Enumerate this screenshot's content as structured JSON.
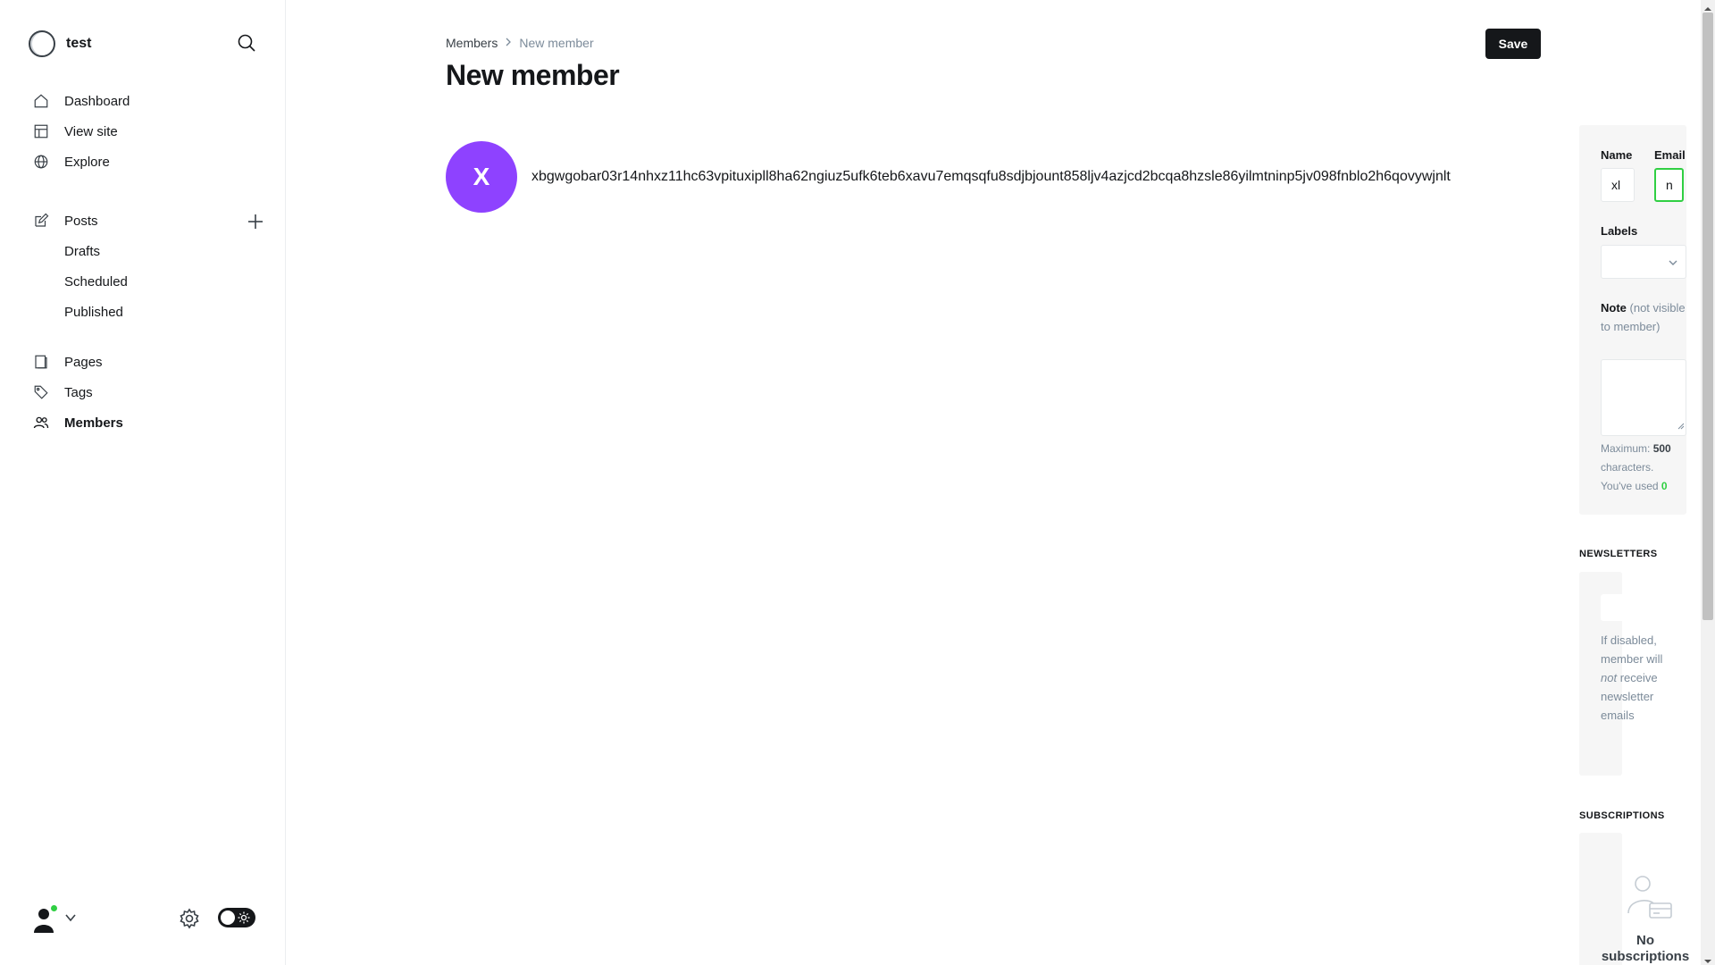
{
  "sidebar": {
    "brand": "test",
    "nav_main": [
      {
        "label": "Dashboard",
        "icon": "home-icon"
      },
      {
        "label": "View site",
        "icon": "layout-icon"
      },
      {
        "label": "Explore",
        "icon": "globe-icon"
      }
    ],
    "posts": {
      "label": "Posts",
      "sub": [
        "Drafts",
        "Scheduled",
        "Published"
      ]
    },
    "nav_bottom": [
      {
        "label": "Pages",
        "icon": "page-icon"
      },
      {
        "label": "Tags",
        "icon": "tag-icon"
      },
      {
        "label": "Members",
        "icon": "members-icon",
        "active": true
      }
    ]
  },
  "header": {
    "breadcrumb_parent": "Members",
    "breadcrumb_current": "New member",
    "title": "New member",
    "save_label": "Save"
  },
  "member": {
    "initial": "X",
    "name": "xbgwgobar03r14nhxz11hc63vpituxipll8ha62ngiuz5ufk6teb6xavu7emqsqfu8sdjbjount858ljv4azjcd2bcqa8hzsle86yilmtninp5jv098fnblo2h6qovywjnlt"
  },
  "form": {
    "name_label": "Name",
    "name_value": "xl",
    "email_label": "Email",
    "email_value": "n",
    "labels_label": "Labels",
    "note_label": "Note",
    "note_sub": "(not visible to member)",
    "note_value": "",
    "max_text": "Maximum:",
    "max_value": "500",
    "chars_text": "characters. You've used",
    "used_value": "0"
  },
  "newsletters": {
    "title": "NEWSLETTERS",
    "hint_before": "If disabled, member will",
    "hint_em": "not",
    "hint_after": "receive newsletter emails"
  },
  "subscriptions": {
    "title": "SUBSCRIPTIONS",
    "empty": "No subscriptions"
  },
  "colors": {
    "accent": "#30cf43",
    "avatar_bg": "#8e42ff",
    "button_bg": "#15171a"
  }
}
